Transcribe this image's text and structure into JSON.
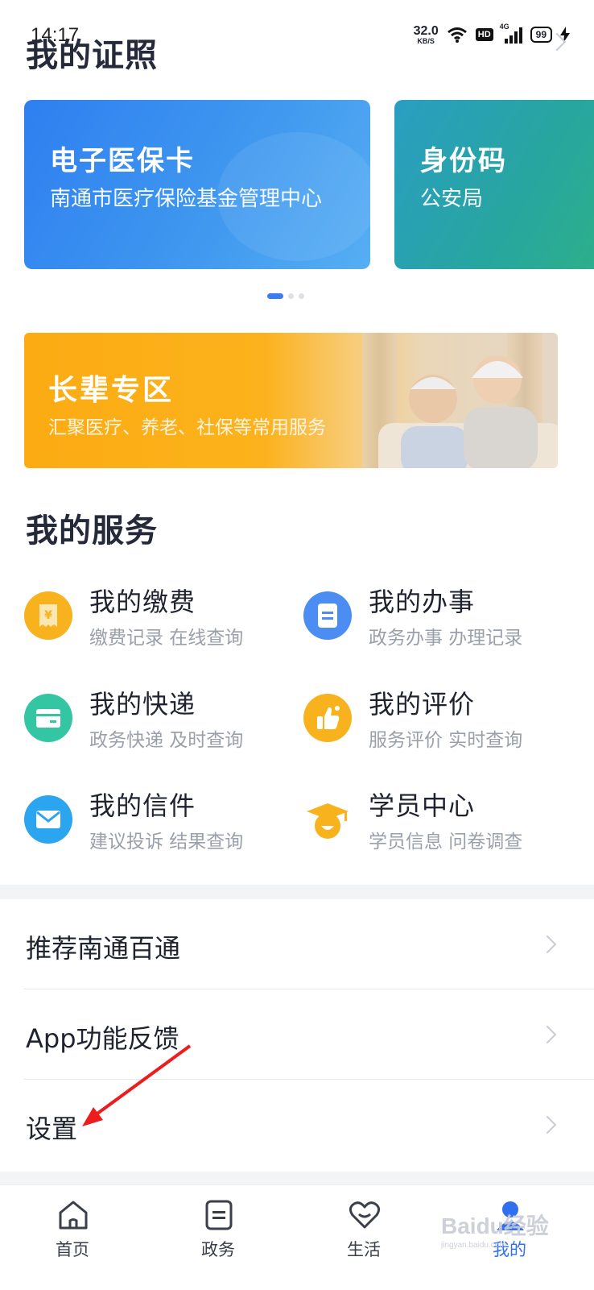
{
  "status_bar": {
    "time": "14:17",
    "net_speed": "32.0",
    "net_unit": "KB/S",
    "hd": "HD",
    "network": "4G",
    "battery": "99"
  },
  "certificates": {
    "title": "我的证照",
    "cards": [
      {
        "title": "电子医保卡",
        "subtitle": "南通市医疗保险基金管理中心",
        "color": "#3a8ef0"
      },
      {
        "title": "身份码",
        "subtitle": "公安局",
        "color": "#27a69f"
      }
    ],
    "page_count": 3,
    "active_page": 1
  },
  "elder_banner": {
    "title": "长辈专区",
    "subtitle": "汇聚医疗、养老、社保等常用服务"
  },
  "services": {
    "title": "我的服务",
    "items": [
      {
        "name": "我的缴费",
        "desc": "缴费记录 在线查询",
        "icon": "payment-icon",
        "color": "#f7b21e"
      },
      {
        "name": "我的办事",
        "desc": "政务办事 办理记录",
        "icon": "affairs-icon",
        "color": "#4b8df2"
      },
      {
        "name": "我的快递",
        "desc": "政务快递 及时查询",
        "icon": "express-icon",
        "color": "#34c6a3"
      },
      {
        "name": "我的评价",
        "desc": "服务评价 实时查询",
        "icon": "thumbs-up-icon",
        "color": "#f7b21e"
      },
      {
        "name": "我的信件",
        "desc": "建议投诉 结果查询",
        "icon": "mail-icon",
        "color": "#2ba5f0"
      },
      {
        "name": "学员中心",
        "desc": "学员信息 问卷调查",
        "icon": "student-icon",
        "color": "#f7b21e"
      }
    ]
  },
  "menu": {
    "items": [
      {
        "label": "推荐南通百通"
      },
      {
        "label": "App功能反馈"
      },
      {
        "label": "设置"
      }
    ]
  },
  "bottom_nav": {
    "items": [
      {
        "label": "首页",
        "icon": "home-icon"
      },
      {
        "label": "政务",
        "icon": "document-icon"
      },
      {
        "label": "生活",
        "icon": "heart-icon"
      },
      {
        "label": "我的",
        "icon": "user-icon"
      }
    ],
    "active_index": 3,
    "accent": "#2f6ff0"
  },
  "watermark": {
    "text": "Baidu经验",
    "sub": "jingyan.baidu.com"
  }
}
